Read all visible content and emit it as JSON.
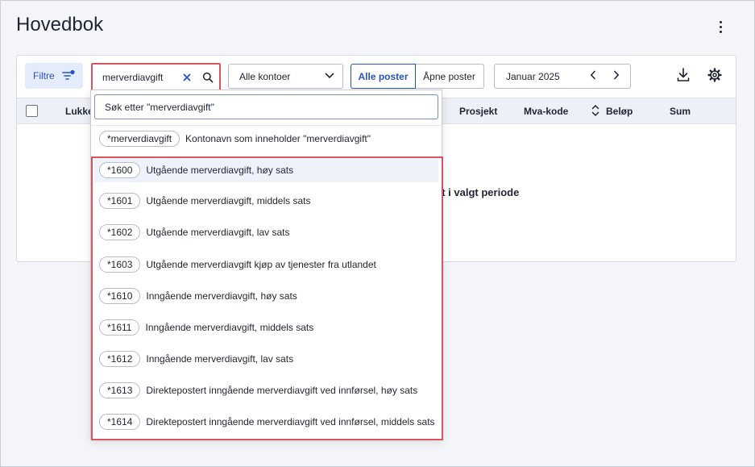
{
  "page": {
    "title": "Hovedbok"
  },
  "toolbar": {
    "filter_label": "Filtre",
    "search_value": "merverdiavgift",
    "accounts_select": "Alle kontoer",
    "seg_all": "Alle poster",
    "seg_open": "Åpne poster",
    "period": "Januar 2025"
  },
  "table": {
    "headers": {
      "closed": "Lukke",
      "project": "Prosjekt",
      "vat": "Mva-kode",
      "amount": "Beløp",
      "sum": "Sum"
    },
    "empty_text": "et i valgt periode"
  },
  "dropdown": {
    "search_prompt": "Søk etter \"merverdiavgift\"",
    "name_filter": {
      "chip": "*merverdiavgift",
      "label": "Kontonavn som inneholder \"merverdiavgift\""
    },
    "accounts": [
      {
        "code": "*1600",
        "name": "Utgående merverdiavgift, høy sats"
      },
      {
        "code": "*1601",
        "name": "Utgående merverdiavgift, middels sats"
      },
      {
        "code": "*1602",
        "name": "Utgående merverdiavgift, lav sats"
      },
      {
        "code": "*1603",
        "name": "Utgående merverdiavgift kjøp av tjenester fra utlandet"
      },
      {
        "code": "*1610",
        "name": "Inngående merverdiavgift, høy sats"
      },
      {
        "code": "*1611",
        "name": "Inngående merverdiavgift, middels sats"
      },
      {
        "code": "*1612",
        "name": "Inngående merverdiavgift, lav sats"
      },
      {
        "code": "*1613",
        "name": "Direktepostert inngående merverdiavgift ved innførsel, høy sats"
      },
      {
        "code": "*1614",
        "name": "Direktepostert inngående merverdiavgift ved innførsel, middels sats"
      }
    ]
  },
  "colors": {
    "accent": "#2553c6",
    "highlight": "#d95462"
  }
}
